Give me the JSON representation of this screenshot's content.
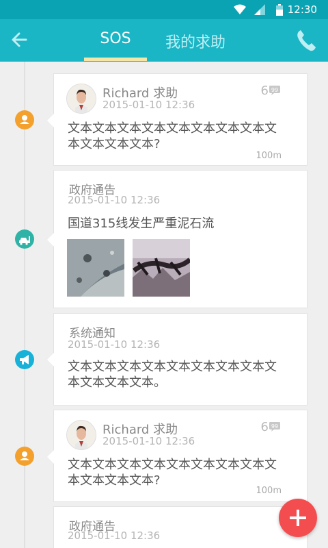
{
  "status_bar": {
    "time": "12:30"
  },
  "app_bar": {
    "tabs": [
      {
        "label": "SOS",
        "active": true
      },
      {
        "label": "我的求助",
        "active": false
      }
    ]
  },
  "colors": {
    "primary": "#1ab6c6",
    "status_bar": "#0aa3b3",
    "tab_underline": "#f3e6a6",
    "node_sos": "#f4a02c",
    "node_gov": "#2fb3a6",
    "node_system": "#18b1d8",
    "fab": "#f44d50"
  },
  "feed": [
    {
      "type": "help",
      "icon": "person-icon",
      "user": "Richard 求助",
      "time": "2015-01-10 12:36",
      "comments": "6",
      "text": "文本文本文本文本文本文本文本文本文本文本文本文本?",
      "distance": "100m"
    },
    {
      "type": "government",
      "icon": "car-icon",
      "title": "政府通告",
      "time": "2015-01-10 12:36",
      "text": "国道315线发生严重泥石流",
      "images": [
        "mudslide-rock-image",
        "mudslide-poster-image"
      ]
    },
    {
      "type": "system",
      "icon": "megaphone-icon",
      "title": "系统通知",
      "time": "2015-01-10 12:36",
      "text": "文本文本文本文本文本文本文本文本文本文本文本文本。"
    },
    {
      "type": "help",
      "icon": "person-icon",
      "user": "Richard 求助",
      "time": "2015-01-10 12:36",
      "comments": "6",
      "text": "文本文本文本文本文本文本文本文本文本文本文本文本?",
      "distance": "100m"
    },
    {
      "type": "government",
      "icon": "car-icon",
      "title": "政府通告",
      "time": "2015-01-10 12:36"
    }
  ]
}
